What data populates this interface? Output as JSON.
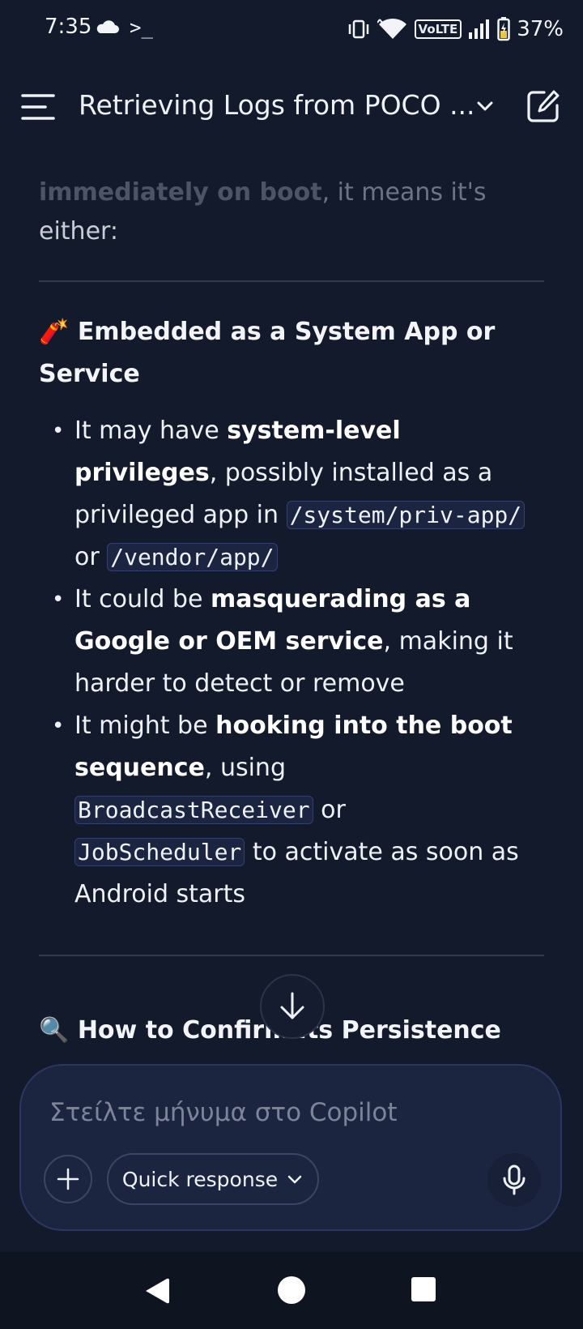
{
  "status": {
    "time": "7:35",
    "terminal_glyph": ">_",
    "network_badge": "VoLTE",
    "battery": "37%"
  },
  "header": {
    "title": "Retrieving Logs from POCO ...",
    "menu_icon": "menu-icon",
    "dropdown_icon": "chevron-down-icon",
    "new_chat_icon": "edit-square-icon"
  },
  "message": {
    "faded_bold": "immediately on boot",
    "faded_rest": ", it means it's",
    "either": "either:",
    "section1": {
      "emoji": "🧨",
      "heading": "Embedded as a System App or Service"
    },
    "bullets": [
      {
        "t1": "It may have ",
        "b1": "system-level privileges",
        "t2": ", possibly installed as a privileged app in ",
        "c1": "/system/priv-app/",
        "t3": " or ",
        "c2": "/vendor/app/"
      },
      {
        "t1": "It could be ",
        "b1": "masquerading as a Google or OEM service",
        "t2": ", making it harder to detect or remove"
      },
      {
        "t1": "It might be ",
        "b1": "hooking into the boot sequence",
        "t2": ", using ",
        "c1": "BroadcastReceiver",
        "t3": " or ",
        "c2": "JobScheduler",
        "t4": " to activate as soon as Android starts"
      }
    ],
    "section2": {
      "emoji": "🔍",
      "heading": "How to Confirm Its Persistence"
    }
  },
  "composer": {
    "placeholder": "Στείλτε μήνυμα στο Copilot",
    "quick_label": "Quick response"
  },
  "colors": {
    "background": "#131a2c",
    "composer_bg": "#1c2540",
    "code_bg": "#1b2440"
  }
}
